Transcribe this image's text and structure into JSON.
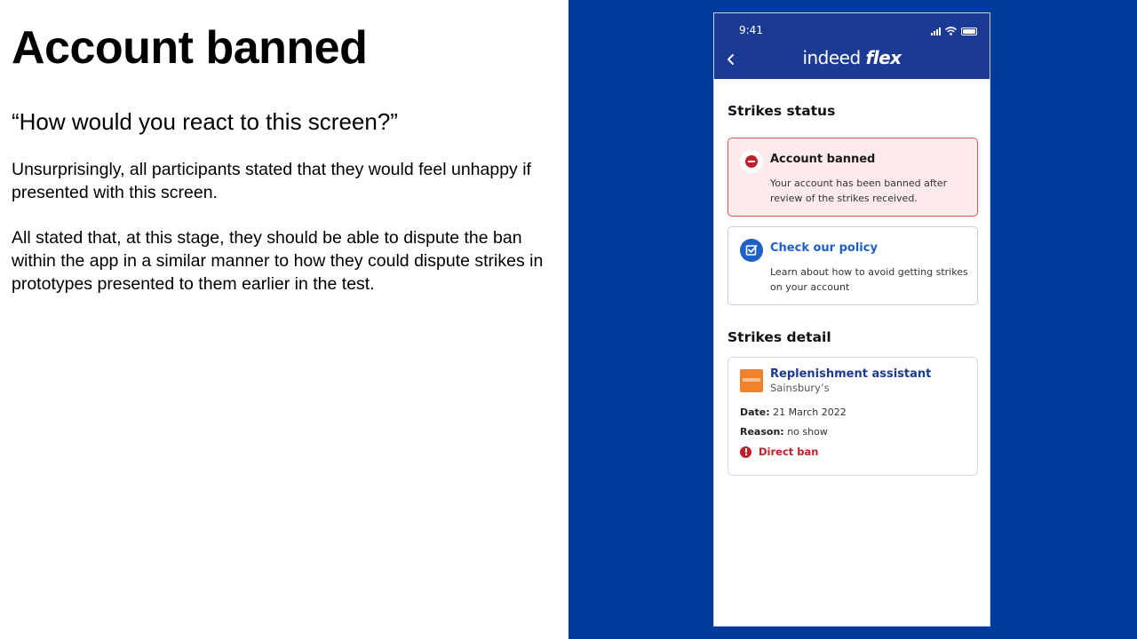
{
  "slide": {
    "title": "Account banned",
    "question": "“How would you react to this screen?”",
    "paragraphs": [
      "Unsurprisingly, all participants stated that they would feel unhappy if presented with this screen.",
      "All stated that, at this stage, they should be able to dispute the ban within the app in a similar manner to how they could dispute strikes in prototypes presented to them earlier in  the test."
    ]
  },
  "colors": {
    "panel_background": "#003a9b",
    "app_header": "#1a3a94",
    "alert_red": "#c0202c",
    "link_blue": "#1e5fc8"
  },
  "phone": {
    "status_bar": {
      "time": "9:41",
      "icons": [
        "signal-icon",
        "wifi-icon",
        "battery-icon"
      ]
    },
    "header": {
      "back_icon": "chevron-left-icon",
      "brand_prefix": "indeed",
      "brand_suffix": "flex"
    },
    "strikes_status": {
      "title": "Strikes status",
      "banned_card": {
        "icon": "minus-circle-icon",
        "heading": "Account banned",
        "body": "Your account has been banned after review of the strikes received."
      },
      "policy_card": {
        "icon": "checkbox-icon",
        "heading": "Check our policy",
        "body": "Learn about how to avoid getting strikes on your account"
      }
    },
    "strikes_detail": {
      "title": "Strikes detail",
      "job": {
        "logo": "sainsburys-logo",
        "title": "Replenishment assistant",
        "company": "Sainsbury’s",
        "date_label": "Date:",
        "date_value": "21 March 2022",
        "reason_label": "Reason:",
        "reason_value": "no show",
        "ban_icon": "alert-circle-icon",
        "ban_label": "Direct ban"
      }
    }
  }
}
